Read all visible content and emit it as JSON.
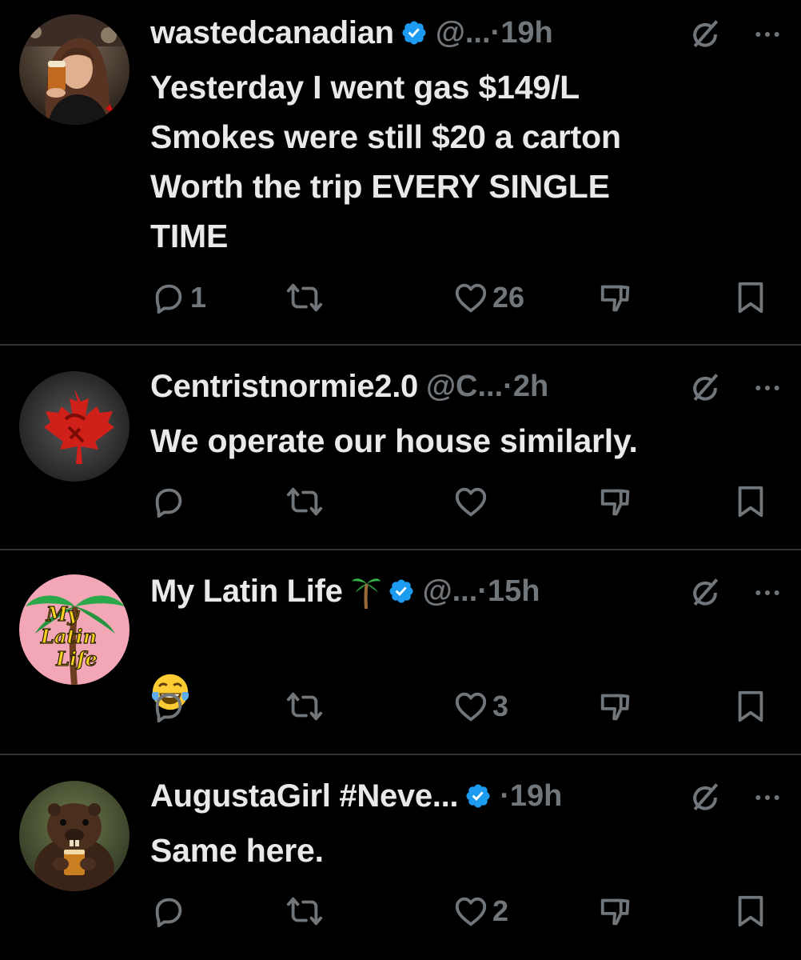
{
  "colors": {
    "background": "#000000",
    "text": "#e7e9ea",
    "muted": "#71767b",
    "verified": "#1d9bf0",
    "divider": "#2f3336"
  },
  "posts": [
    {
      "name": "wastedcanadian",
      "verified": true,
      "handle": "@...",
      "time": "·19h",
      "text": "Yesterday I went gas $149/L\nSmokes were still $20 a carton\nWorth the trip EVERY SINGLE\nTIME",
      "replies": "1",
      "reposts": "",
      "likes": "26",
      "avatar_icon": "woman-with-beer-avatar"
    },
    {
      "name": "Centristnormie2.0",
      "verified": false,
      "handle": "@C...",
      "time": "·2h",
      "text": "We operate our house similarly.",
      "replies": "",
      "reposts": "",
      "likes": "",
      "avatar_icon": "maple-leaf-hammer-sickle-avatar"
    },
    {
      "name": "My Latin Life",
      "verified": true,
      "handle": "@...",
      "time": "·15h",
      "emoji": "face-with-tears-of-joy",
      "replies": "",
      "reposts": "",
      "likes": "3",
      "avatar_icon": "my-latin-life-logo-avatar",
      "avatar_text": [
        "My",
        "Latin",
        "Life"
      ]
    },
    {
      "name": "AugustaGirl #Neve...",
      "verified": true,
      "handle": "",
      "time": "·19h",
      "text": "Same here.",
      "replies": "",
      "reposts": "",
      "likes": "2",
      "avatar_icon": "beaver-with-drink-avatar"
    }
  ]
}
